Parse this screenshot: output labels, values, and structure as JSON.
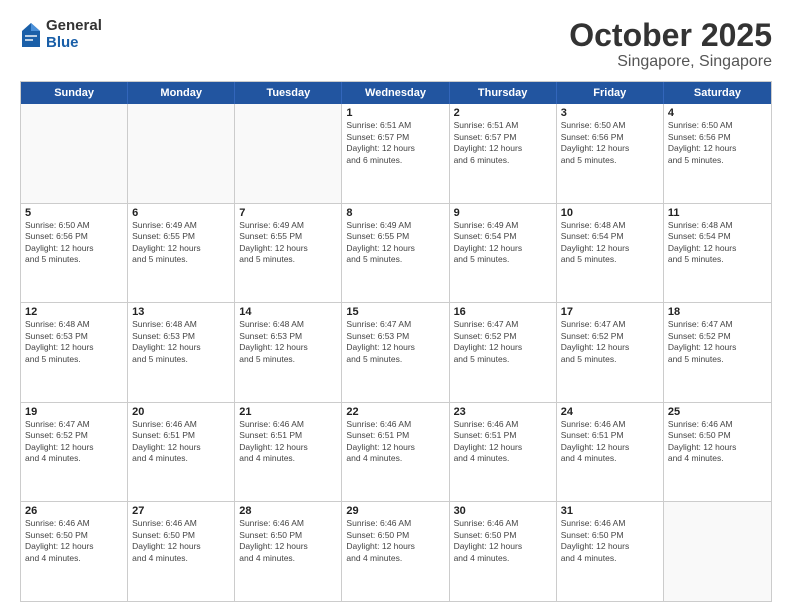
{
  "header": {
    "logo": {
      "general": "General",
      "blue": "Blue"
    },
    "title": "October 2025",
    "subtitle": "Singapore, Singapore"
  },
  "weekdays": [
    "Sunday",
    "Monday",
    "Tuesday",
    "Wednesday",
    "Thursday",
    "Friday",
    "Saturday"
  ],
  "weeks": [
    [
      {
        "day": "",
        "info": "",
        "empty": true
      },
      {
        "day": "",
        "info": "",
        "empty": true
      },
      {
        "day": "",
        "info": "",
        "empty": true
      },
      {
        "day": "1",
        "info": "Sunrise: 6:51 AM\nSunset: 6:57 PM\nDaylight: 12 hours\nand 6 minutes."
      },
      {
        "day": "2",
        "info": "Sunrise: 6:51 AM\nSunset: 6:57 PM\nDaylight: 12 hours\nand 6 minutes."
      },
      {
        "day": "3",
        "info": "Sunrise: 6:50 AM\nSunset: 6:56 PM\nDaylight: 12 hours\nand 5 minutes."
      },
      {
        "day": "4",
        "info": "Sunrise: 6:50 AM\nSunset: 6:56 PM\nDaylight: 12 hours\nand 5 minutes."
      }
    ],
    [
      {
        "day": "5",
        "info": "Sunrise: 6:50 AM\nSunset: 6:56 PM\nDaylight: 12 hours\nand 5 minutes."
      },
      {
        "day": "6",
        "info": "Sunrise: 6:49 AM\nSunset: 6:55 PM\nDaylight: 12 hours\nand 5 minutes."
      },
      {
        "day": "7",
        "info": "Sunrise: 6:49 AM\nSunset: 6:55 PM\nDaylight: 12 hours\nand 5 minutes."
      },
      {
        "day": "8",
        "info": "Sunrise: 6:49 AM\nSunset: 6:55 PM\nDaylight: 12 hours\nand 5 minutes."
      },
      {
        "day": "9",
        "info": "Sunrise: 6:49 AM\nSunset: 6:54 PM\nDaylight: 12 hours\nand 5 minutes."
      },
      {
        "day": "10",
        "info": "Sunrise: 6:48 AM\nSunset: 6:54 PM\nDaylight: 12 hours\nand 5 minutes."
      },
      {
        "day": "11",
        "info": "Sunrise: 6:48 AM\nSunset: 6:54 PM\nDaylight: 12 hours\nand 5 minutes."
      }
    ],
    [
      {
        "day": "12",
        "info": "Sunrise: 6:48 AM\nSunset: 6:53 PM\nDaylight: 12 hours\nand 5 minutes."
      },
      {
        "day": "13",
        "info": "Sunrise: 6:48 AM\nSunset: 6:53 PM\nDaylight: 12 hours\nand 5 minutes."
      },
      {
        "day": "14",
        "info": "Sunrise: 6:48 AM\nSunset: 6:53 PM\nDaylight: 12 hours\nand 5 minutes."
      },
      {
        "day": "15",
        "info": "Sunrise: 6:47 AM\nSunset: 6:53 PM\nDaylight: 12 hours\nand 5 minutes."
      },
      {
        "day": "16",
        "info": "Sunrise: 6:47 AM\nSunset: 6:52 PM\nDaylight: 12 hours\nand 5 minutes."
      },
      {
        "day": "17",
        "info": "Sunrise: 6:47 AM\nSunset: 6:52 PM\nDaylight: 12 hours\nand 5 minutes."
      },
      {
        "day": "18",
        "info": "Sunrise: 6:47 AM\nSunset: 6:52 PM\nDaylight: 12 hours\nand 5 minutes."
      }
    ],
    [
      {
        "day": "19",
        "info": "Sunrise: 6:47 AM\nSunset: 6:52 PM\nDaylight: 12 hours\nand 4 minutes."
      },
      {
        "day": "20",
        "info": "Sunrise: 6:46 AM\nSunset: 6:51 PM\nDaylight: 12 hours\nand 4 minutes."
      },
      {
        "day": "21",
        "info": "Sunrise: 6:46 AM\nSunset: 6:51 PM\nDaylight: 12 hours\nand 4 minutes."
      },
      {
        "day": "22",
        "info": "Sunrise: 6:46 AM\nSunset: 6:51 PM\nDaylight: 12 hours\nand 4 minutes."
      },
      {
        "day": "23",
        "info": "Sunrise: 6:46 AM\nSunset: 6:51 PM\nDaylight: 12 hours\nand 4 minutes."
      },
      {
        "day": "24",
        "info": "Sunrise: 6:46 AM\nSunset: 6:51 PM\nDaylight: 12 hours\nand 4 minutes."
      },
      {
        "day": "25",
        "info": "Sunrise: 6:46 AM\nSunset: 6:50 PM\nDaylight: 12 hours\nand 4 minutes."
      }
    ],
    [
      {
        "day": "26",
        "info": "Sunrise: 6:46 AM\nSunset: 6:50 PM\nDaylight: 12 hours\nand 4 minutes."
      },
      {
        "day": "27",
        "info": "Sunrise: 6:46 AM\nSunset: 6:50 PM\nDaylight: 12 hours\nand 4 minutes."
      },
      {
        "day": "28",
        "info": "Sunrise: 6:46 AM\nSunset: 6:50 PM\nDaylight: 12 hours\nand 4 minutes."
      },
      {
        "day": "29",
        "info": "Sunrise: 6:46 AM\nSunset: 6:50 PM\nDaylight: 12 hours\nand 4 minutes."
      },
      {
        "day": "30",
        "info": "Sunrise: 6:46 AM\nSunset: 6:50 PM\nDaylight: 12 hours\nand 4 minutes."
      },
      {
        "day": "31",
        "info": "Sunrise: 6:46 AM\nSunset: 6:50 PM\nDaylight: 12 hours\nand 4 minutes."
      },
      {
        "day": "",
        "info": "",
        "empty": true
      }
    ]
  ]
}
